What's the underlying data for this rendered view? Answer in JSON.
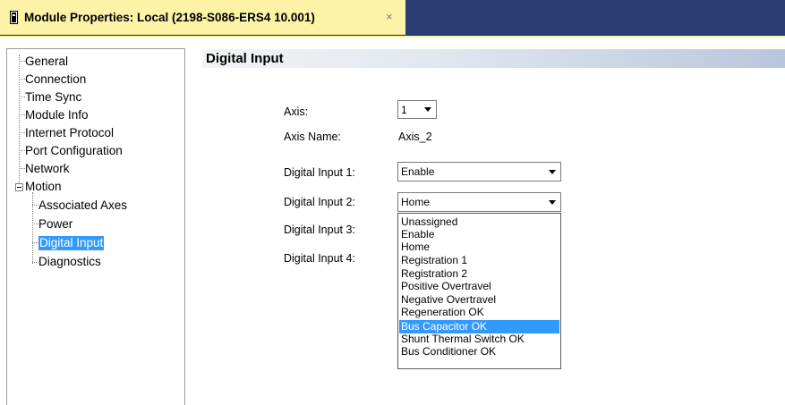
{
  "window": {
    "tab_title": "Module Properties: Local (2198-S086-ERS4 10.001)",
    "close_glyph": "×"
  },
  "tree": {
    "items": [
      {
        "label": "General"
      },
      {
        "label": "Connection"
      },
      {
        "label": "Time Sync"
      },
      {
        "label": "Module Info"
      },
      {
        "label": "Internet Protocol"
      },
      {
        "label": "Port Configuration"
      },
      {
        "label": "Network"
      },
      {
        "label": "Motion"
      },
      {
        "label": "Associated Axes"
      },
      {
        "label": "Power"
      },
      {
        "label": "Digital Input",
        "selected": true
      },
      {
        "label": "Diagnostics"
      }
    ]
  },
  "section": {
    "title": "Digital Input"
  },
  "form": {
    "axis_label": "Axis:",
    "axis_value": "1",
    "axis_name_label": "Axis Name:",
    "axis_name_value": "Axis_2",
    "di1_label": "Digital Input 1:",
    "di1_value": "Enable",
    "di2_label": "Digital Input 2:",
    "di2_value": "Home",
    "di3_label": "Digital Input 3:",
    "di4_label": "Digital Input 4:"
  },
  "dropdown": {
    "options": [
      "Unassigned",
      "Enable",
      "Home",
      "Registration 1",
      "Registration 2",
      "Positive Overtravel",
      "Negative Overtravel",
      "Regeneration OK",
      "Bus Capacitor OK",
      "Shunt Thermal Switch OK",
      "Bus Conditioner OK"
    ],
    "highlighted": "Bus Capacitor OK"
  },
  "colors": {
    "titlebar": "#2b3e73",
    "tab": "#fdf3a7",
    "selection": "#3399ff"
  }
}
